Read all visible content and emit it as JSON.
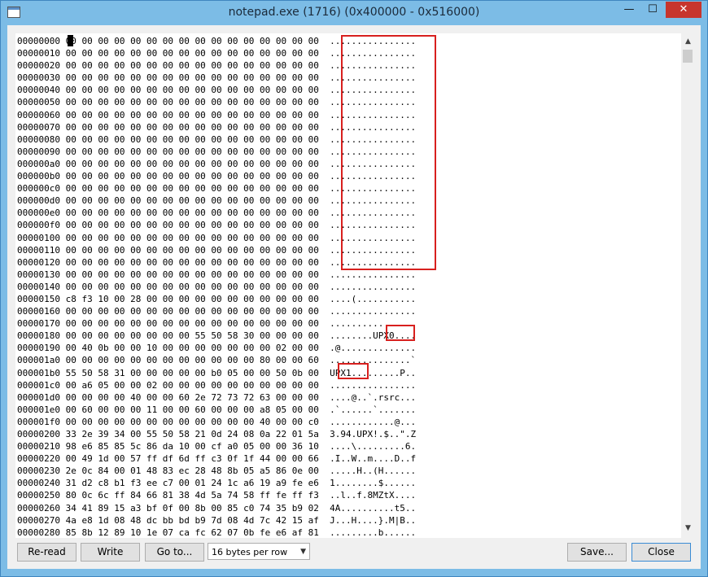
{
  "window": {
    "title": "notepad.exe (1716) (0x400000 - 0x516000)",
    "min_glyph": "—",
    "max_glyph": "☐",
    "close_glyph": "✕"
  },
  "hex": {
    "lines": "00000000 00 00 00 00 00 00 00 00 00 00 00 00 00 00 00 00  ................\n00000010 00 00 00 00 00 00 00 00 00 00 00 00 00 00 00 00  ................\n00000020 00 00 00 00 00 00 00 00 00 00 00 00 00 00 00 00  ................\n00000030 00 00 00 00 00 00 00 00 00 00 00 00 00 00 00 00  ................\n00000040 00 00 00 00 00 00 00 00 00 00 00 00 00 00 00 00  ................\n00000050 00 00 00 00 00 00 00 00 00 00 00 00 00 00 00 00  ................\n00000060 00 00 00 00 00 00 00 00 00 00 00 00 00 00 00 00  ................\n00000070 00 00 00 00 00 00 00 00 00 00 00 00 00 00 00 00  ................\n00000080 00 00 00 00 00 00 00 00 00 00 00 00 00 00 00 00  ................\n00000090 00 00 00 00 00 00 00 00 00 00 00 00 00 00 00 00  ................\n000000a0 00 00 00 00 00 00 00 00 00 00 00 00 00 00 00 00  ................\n000000b0 00 00 00 00 00 00 00 00 00 00 00 00 00 00 00 00  ................\n000000c0 00 00 00 00 00 00 00 00 00 00 00 00 00 00 00 00  ................\n000000d0 00 00 00 00 00 00 00 00 00 00 00 00 00 00 00 00  ................\n000000e0 00 00 00 00 00 00 00 00 00 00 00 00 00 00 00 00  ................\n000000f0 00 00 00 00 00 00 00 00 00 00 00 00 00 00 00 00  ................\n00000100 00 00 00 00 00 00 00 00 00 00 00 00 00 00 00 00  ................\n00000110 00 00 00 00 00 00 00 00 00 00 00 00 00 00 00 00  ................\n00000120 00 00 00 00 00 00 00 00 00 00 00 00 00 00 00 00  ................\n00000130 00 00 00 00 00 00 00 00 00 00 00 00 00 00 00 00  ................\n00000140 00 00 00 00 00 00 00 00 00 00 00 00 00 00 00 00  ................\n00000150 c8 f3 10 00 28 00 00 00 00 00 00 00 00 00 00 00  ....(...........\n00000160 00 00 00 00 00 00 00 00 00 00 00 00 00 00 00 00  ................\n00000170 00 00 00 00 00 00 00 00 00 00 00 00 00 00 00 00  ................\n00000180 00 00 00 00 00 00 00 00 55 50 58 30 00 00 00 00  ........UPX0....\n00000190 00 40 0b 00 00 10 00 00 00 00 00 00 00 02 00 00  .@..............\n000001a0 00 00 00 00 00 00 00 00 00 00 00 00 80 00 00 60  ...............`\n000001b0 55 50 58 31 00 00 00 00 00 b0 05 00 00 50 0b 00  UPX1.........P..\n000001c0 00 a6 05 00 00 02 00 00 00 00 00 00 00 00 00 00  ................\n000001d0 00 00 00 00 40 00 00 60 2e 72 73 72 63 00 00 00  ....@..`.rsrc...\n000001e0 00 60 00 00 00 11 00 00 60 00 00 00 a8 05 00 00  .`......`.......\n000001f0 00 00 00 00 00 00 00 00 00 00 00 00 40 00 00 c0  ............@...\n00000200 33 2e 39 34 00 55 50 58 21 0d 24 08 0a 22 01 5a  3.94.UPX!.$..\".Z\n00000210 98 e6 85 85 5c 86 da 10 00 cf a0 05 00 00 36 10  ....\\.........6.\n00000220 00 49 1d 00 57 ff df 6d ff c3 0f 1f 44 00 00 66  .I..W..m....D..f\n00000230 2e 0c 84 00 01 48 83 ec 28 48 8b 05 a5 86 0e 00  .....H..(H......\n00000240 31 d2 c8 b1 f3 ee c7 00 01 24 1c a6 19 a9 fe e6  1........$......\n00000250 80 0c 6c ff 84 66 81 38 4d 5a 74 58 ff fe ff f3  ..l..f.8MZtX....\n00000260 34 41 89 15 a3 bf 0f 00 8b 00 85 c0 74 35 b9 02  4A..........t5..\n00000270 4a e8 1d 08 48 dc bb bd b9 7d 08 4d 7c 42 15 af  J...H....}.M|B..\n00000280 85 8b 12 89 10 1e 07 ca fc 62 07 0b fe e6 af 81  .........b......"
  },
  "scrollbar": {
    "up_glyph": "▲",
    "down_glyph": "▼"
  },
  "buttons": {
    "reread": "Re-read",
    "write": "Write",
    "goto": "Go to...",
    "save": "Save...",
    "close": "Close"
  },
  "bytes_per_row": {
    "selected": "16 bytes per row",
    "arrow_glyph": "▼"
  }
}
